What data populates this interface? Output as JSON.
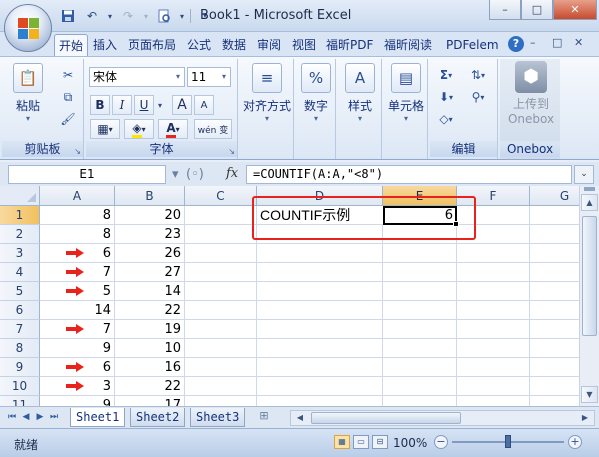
{
  "window": {
    "title": "Book1 - Microsoft Excel",
    "controls": [
      "–",
      "□",
      "✕"
    ]
  },
  "quick_access": {
    "save_icon": "save-icon",
    "undo_icon": "undo-icon",
    "redo_icon": "redo-icon",
    "print_preview_icon": "print-preview-icon",
    "customize_icon": "customize-icon"
  },
  "ribbon_tabs": [
    "开始",
    "插入",
    "页面布局",
    "公式",
    "数据",
    "审阅",
    "视图",
    "福昕PDF",
    "福昕阅读",
    "PDFelem"
  ],
  "ribbon_tab_active": "开始",
  "ribbon": {
    "clipboard": {
      "label": "剪贴板",
      "paste": "粘贴"
    },
    "font": {
      "label": "字体",
      "font_name": "宋体",
      "font_size": "11",
      "bold": "B",
      "italic": "I",
      "underline": "U",
      "grow": "A",
      "shrink": "A",
      "wen": "wén 变"
    },
    "alignment": {
      "label": "对齐方式"
    },
    "number": {
      "label": "数字",
      "symbol": "%"
    },
    "styles": {
      "label": "样式",
      "symbol": "A"
    },
    "cells": {
      "label": "单元格"
    },
    "editing": {
      "label": "编辑",
      "sum": "Σ"
    },
    "onebox": {
      "label": "Onebox",
      "upload": "上传到",
      "upload2": "Onebox"
    }
  },
  "formula_bar": {
    "name_box": "E1",
    "fx": "fx",
    "formula": "=COUNTIF(A:A,\"<8\")"
  },
  "grid": {
    "columns": [
      "A",
      "B",
      "C",
      "D",
      "E",
      "F",
      "G"
    ],
    "selected_column": "E",
    "rows": [
      {
        "n": "1",
        "a": "8",
        "b": "20",
        "arrow": false
      },
      {
        "n": "2",
        "a": "8",
        "b": "23",
        "arrow": false
      },
      {
        "n": "3",
        "a": "6",
        "b": "26",
        "arrow": true
      },
      {
        "n": "4",
        "a": "7",
        "b": "27",
        "arrow": true
      },
      {
        "n": "5",
        "a": "5",
        "b": "14",
        "arrow": true
      },
      {
        "n": "6",
        "a": "14",
        "b": "22",
        "arrow": false
      },
      {
        "n": "7",
        "a": "7",
        "b": "19",
        "arrow": true
      },
      {
        "n": "8",
        "a": "9",
        "b": "10",
        "arrow": false
      },
      {
        "n": "9",
        "a": "6",
        "b": "16",
        "arrow": true
      },
      {
        "n": "10",
        "a": "3",
        "b": "22",
        "arrow": true
      },
      {
        "n": "11",
        "a": "9",
        "b": "17",
        "arrow": false
      }
    ],
    "d1": "COUNTIF示例",
    "e1": "6",
    "arrow_color": "#e8231c"
  },
  "sheets": [
    "Sheet1",
    "Sheet2",
    "Sheet3"
  ],
  "active_sheet": "Sheet1",
  "status": {
    "ready": "就绪",
    "zoom": "100%"
  }
}
